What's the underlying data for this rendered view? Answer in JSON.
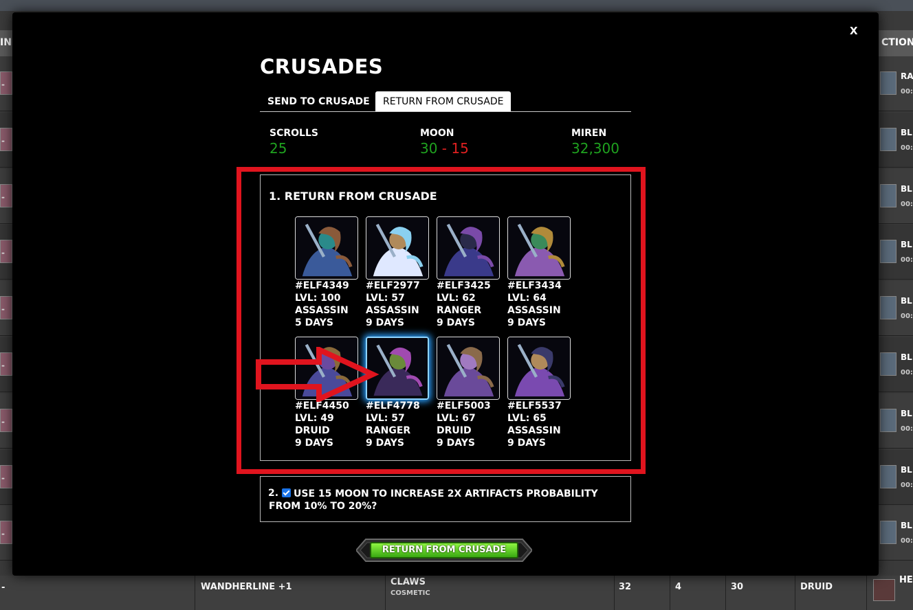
{
  "background": {
    "header_left": "IN",
    "header_right": "CTION",
    "row_dash": "-",
    "rows": [
      {
        "title": "RA",
        "time": "00:"
      },
      {
        "title": "BL",
        "time": "00:"
      },
      {
        "title": "BL",
        "time": "00:"
      },
      {
        "title": "BL",
        "time": "00:"
      },
      {
        "title": "BL",
        "time": "00:"
      },
      {
        "title": "BL",
        "time": "00:"
      },
      {
        "title": "BL",
        "time": "00:"
      },
      {
        "title": "BL",
        "time": "00:"
      },
      {
        "title": "BL",
        "time": "00:"
      }
    ],
    "bottom_row": {
      "dash": "-",
      "name": "WANDHERLINE +1",
      "type": "CLAWS",
      "subtype": "COSMETIC",
      "v1": "32",
      "v2": "4",
      "v3": "30",
      "class": "DRUID",
      "action": "HE"
    }
  },
  "modal": {
    "close_label": "X",
    "title": "CRUSADES",
    "tabs": {
      "send": "SEND TO CRUSADE",
      "return": "RETURN FROM CRUSADE",
      "active": "return"
    },
    "stats": {
      "scrolls_label": "SCROLLS",
      "scrolls_value": "25",
      "moon_label": "MOON",
      "moon_value": "30",
      "moon_sep": " - ",
      "moon_cost": "15",
      "miren_label": "MIREN",
      "miren_value": "32,300"
    },
    "section1_title": "1. RETURN FROM CRUSADE",
    "elves": [
      {
        "id": "#ELF4349",
        "level": "LVL: 100",
        "class": "ASSASSIN",
        "days": "5 DAYS",
        "selected": false
      },
      {
        "id": "#ELF2977",
        "level": "LVL: 57",
        "class": "ASSASSIN",
        "days": "9 DAYS",
        "selected": false
      },
      {
        "id": "#ELF3425",
        "level": "LVL: 62",
        "class": "RANGER",
        "days": "9 DAYS",
        "selected": false
      },
      {
        "id": "#ELF3434",
        "level": "LVL: 64",
        "class": "ASSASSIN",
        "days": "9 DAYS",
        "selected": false
      },
      {
        "id": "#ELF4450",
        "level": "LVL: 49",
        "class": "DRUID",
        "days": "9 DAYS",
        "selected": false
      },
      {
        "id": "#ELF4778",
        "level": "LVL: 57",
        "class": "RANGER",
        "days": "9 DAYS",
        "selected": true
      },
      {
        "id": "#ELF5003",
        "level": "LVL: 67",
        "class": "DRUID",
        "days": "9 DAYS",
        "selected": false
      },
      {
        "id": "#ELF5537",
        "level": "LVL: 65",
        "class": "ASSASSIN",
        "days": "9 DAYS",
        "selected": false
      }
    ],
    "section2": {
      "number": "2.",
      "checked": true,
      "text": "USE 15 MOON TO INCREASE 2X ARTIFACTS PROBABILITY FROM 10% TO 20%?"
    },
    "submit_label": "RETURN FROM CRUSADE"
  },
  "colors": {
    "green": "#1fa21f",
    "red": "#e02020",
    "highlight_box": "#e0141e",
    "selected_glow": "#2aa0ff"
  }
}
